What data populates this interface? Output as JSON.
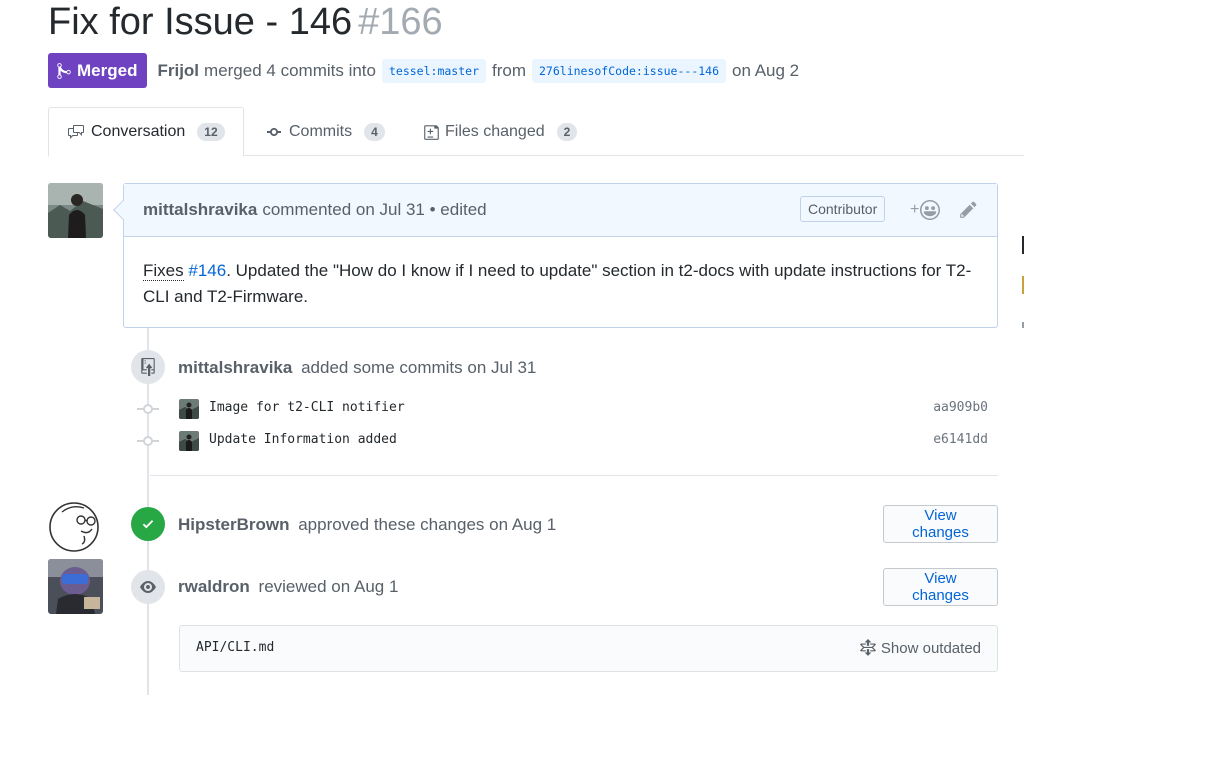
{
  "pr": {
    "title": "Fix for Issue - 146",
    "number": "#166",
    "state_label": "Merged",
    "merger": "Frijol",
    "merge_text_1": "merged 4 commits into",
    "base_branch": "tessel:master",
    "merge_text_2": "from",
    "head_branch": "276linesofCode:issue---146",
    "merge_date": "on Aug 2"
  },
  "tabs": [
    {
      "label": "Conversation",
      "count": "12",
      "icon": "comment-discussion-icon"
    },
    {
      "label": "Commits",
      "count": "4",
      "icon": "git-commit-icon"
    },
    {
      "label": "Files changed",
      "count": "2",
      "icon": "file-diff-icon"
    }
  ],
  "comment": {
    "author": "mittalshravika",
    "meta": "commented on Jul 31 • edited",
    "role_badge": "Contributor",
    "body_fixes": "Fixes",
    "body_issue_link": "#146",
    "body_rest": ". Updated the \"How do I know if I need to update\" section in t2-docs with update instructions for T2-CLI and T2-Firmware."
  },
  "commit_event": {
    "author": "mittalshravika",
    "text": "added some commits on Jul 31",
    "commits": [
      {
        "message": "Image for t2-CLI notifier",
        "sha": "aa909b0"
      },
      {
        "message": "Update Information added",
        "sha": "e6141dd"
      }
    ]
  },
  "approval": {
    "author": "HipsterBrown",
    "text": "approved these changes on Aug 1",
    "button": "View changes"
  },
  "review": {
    "author": "rwaldron",
    "text": "reviewed on Aug 1",
    "button": "View changes",
    "file": "API/CLI.md",
    "outdated_label": "Show outdated"
  },
  "colors": {
    "merged": "#6f42c1",
    "approved": "#28a745",
    "link": "#0366d6"
  }
}
